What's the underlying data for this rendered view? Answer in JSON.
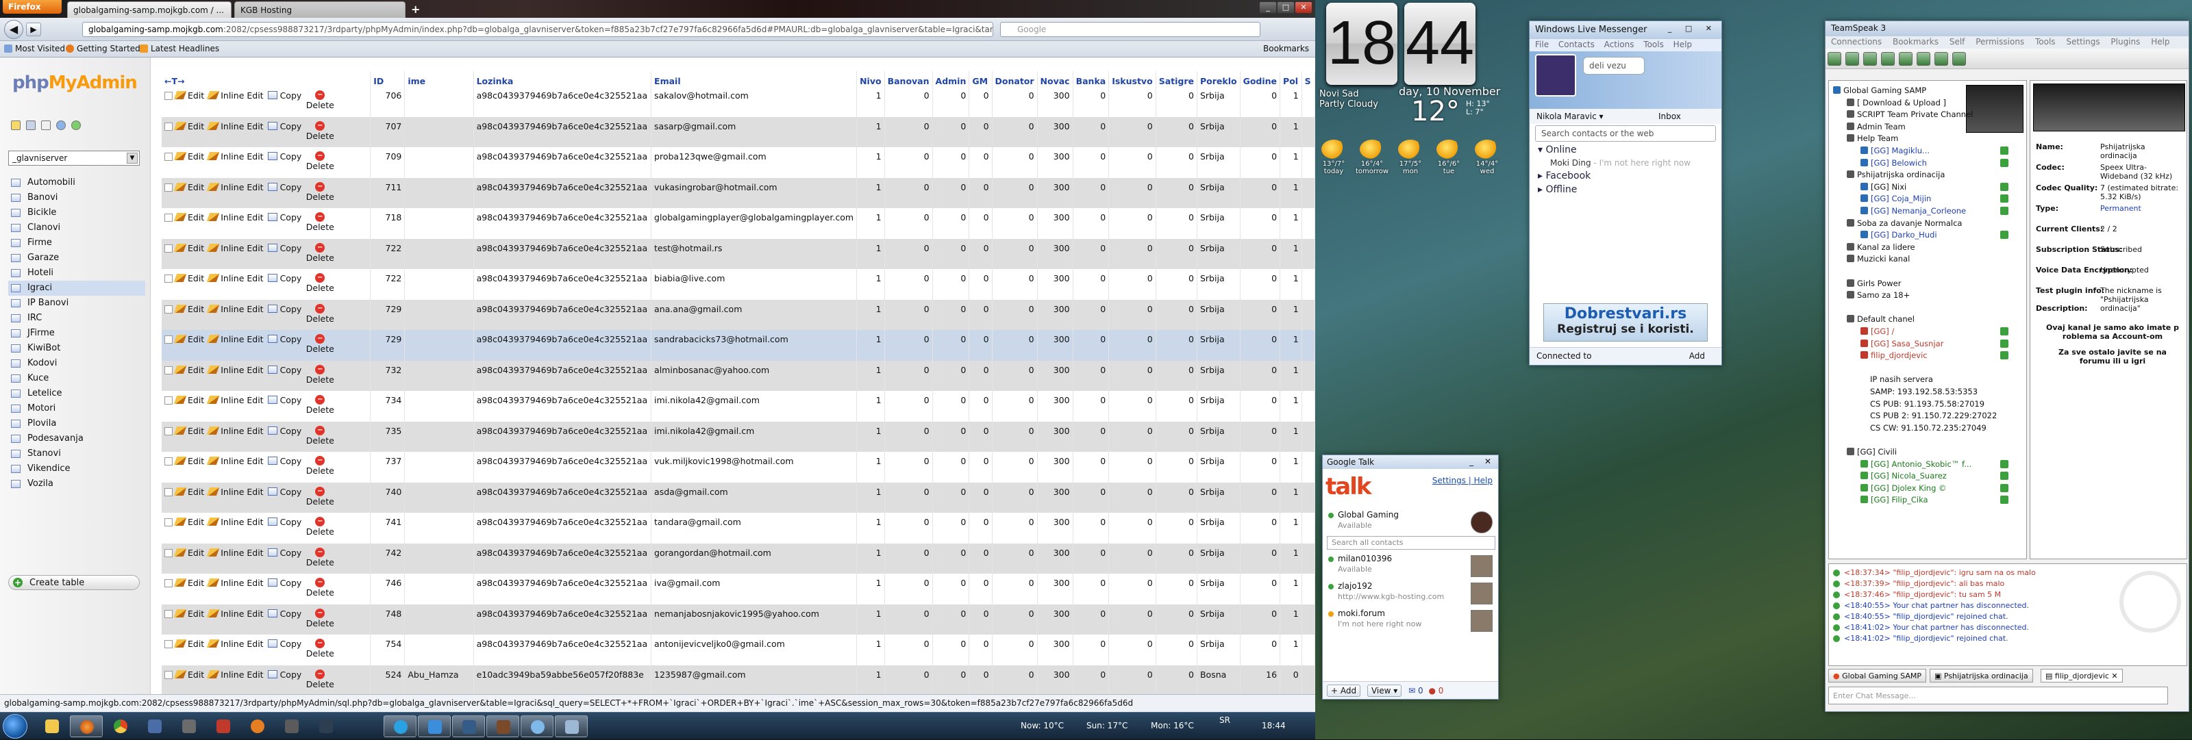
{
  "firefox": {
    "menu_label": "Firefox",
    "tabs": [
      {
        "label": "globalgaming-samp.mojkgb.com / ..."
      },
      {
        "label": "KGB Hosting"
      }
    ],
    "new_tab": "+",
    "url_host": "globalgaming-samp.mojkgb.com",
    "url_rest": ":2082/cpsess988873217/3rdparty/phpMyAdmin/index.php?db=globalga_glavniserver&token=f885a23b7cf27e797fa6c82966fa5d6d#PMAURL:db=globalga_glavniserver&table=Igraci&target=sql.php&t",
    "search_placeholder": "Google",
    "bookmarks": [
      "Most Visited",
      "Getting Started",
      "Latest Headlines"
    ],
    "bookmarks_right": "Bookmarks",
    "status_url": "globalgaming-samp.mojkgb.com:2082/cpsess988873217/3rdparty/phpMyAdmin/sql.php?db=globalga_glavniserver&table=Igraci&sql_query=SELECT+*+FROM+`Igraci`+ORDER+BY+`Igraci`.`ime`+ASC&session_max_rows=30&token=f885a23b7cf27e797fa6c82966fa5d6d"
  },
  "pma": {
    "logo_php": "php",
    "logo_my": "MyAdmin",
    "database": "_glavniserver",
    "tables": [
      "Automobili",
      "Banovi",
      "Bicikle",
      "Clanovi",
      "Firme",
      "Garaze",
      "Hoteli",
      "Igraci",
      "IP Banovi",
      "IRC",
      "JFirme",
      "KiwiBot",
      "Kodovi",
      "Kuce",
      "Letelice",
      "Motori",
      "Plovila",
      "Podesavanja",
      "Stanovi",
      "Vikendice",
      "Vozila"
    ],
    "selected_table": "Igraci",
    "create_table": "Create table",
    "nav_arrows": "←T→",
    "columns": [
      "ID",
      "ime",
      "Lozinka",
      "Email",
      "Nivo",
      "Banovan",
      "Admin",
      "GM",
      "Donator",
      "Novac",
      "Banka",
      "Iskustvo",
      "Satigre",
      "Poreklo",
      "Godine",
      "Pol",
      "S"
    ],
    "actions": {
      "edit": "Edit",
      "inline": "Inline Edit",
      "copy": "Copy",
      "delete": "Delete"
    },
    "rows": [
      [
        "706",
        "",
        "a98c0439379469b7a6ce0e4c325521aa",
        "sakalov@hotmail.com",
        "1",
        "0",
        "0",
        "0",
        "0",
        "300",
        "0",
        "0",
        "0",
        "Srbija",
        "0",
        "1"
      ],
      [
        "707",
        "",
        "a98c0439379469b7a6ce0e4c325521aa",
        "sasarp@gmail.com",
        "1",
        "0",
        "0",
        "0",
        "0",
        "300",
        "0",
        "0",
        "0",
        "Srbija",
        "0",
        "1"
      ],
      [
        "709",
        "",
        "a98c0439379469b7a6ce0e4c325521aa",
        "proba123qwe@gmail.com",
        "1",
        "0",
        "0",
        "0",
        "0",
        "300",
        "0",
        "0",
        "0",
        "Srbija",
        "0",
        "1"
      ],
      [
        "711",
        "",
        "a98c0439379469b7a6ce0e4c325521aa",
        "vukasingrobar@hotmail.com",
        "1",
        "0",
        "0",
        "0",
        "0",
        "300",
        "0",
        "0",
        "0",
        "Srbija",
        "0",
        "1"
      ],
      [
        "718",
        "",
        "a98c0439379469b7a6ce0e4c325521aa",
        "globalgamingplayer@globalgamingplayer.com",
        "1",
        "0",
        "0",
        "0",
        "0",
        "300",
        "0",
        "0",
        "0",
        "Srbija",
        "0",
        "1"
      ],
      [
        "722",
        "",
        "a98c0439379469b7a6ce0e4c325521aa",
        "test@hotmail.rs",
        "1",
        "0",
        "0",
        "0",
        "0",
        "300",
        "0",
        "0",
        "0",
        "Srbija",
        "0",
        "1"
      ],
      [
        "722",
        "",
        "a98c0439379469b7a6ce0e4c325521aa",
        "biabia@live.com",
        "1",
        "0",
        "0",
        "0",
        "0",
        "300",
        "0",
        "0",
        "0",
        "Srbija",
        "0",
        "1"
      ],
      [
        "729",
        "",
        "a98c0439379469b7a6ce0e4c325521aa",
        "ana.ana@gmail.com",
        "1",
        "0",
        "0",
        "0",
        "0",
        "300",
        "0",
        "0",
        "0",
        "Srbija",
        "0",
        "1"
      ],
      [
        "729",
        "",
        "a98c0439379469b7a6ce0e4c325521aa",
        "sandrabacicks73@hotmail.com",
        "1",
        "0",
        "0",
        "0",
        "0",
        "300",
        "0",
        "0",
        "0",
        "Srbija",
        "0",
        "1"
      ],
      [
        "732",
        "",
        "a98c0439379469b7a6ce0e4c325521aa",
        "alminbosanac@yahoo.com",
        "1",
        "0",
        "0",
        "0",
        "0",
        "300",
        "0",
        "0",
        "0",
        "Srbija",
        "0",
        "1"
      ],
      [
        "734",
        "",
        "a98c0439379469b7a6ce0e4c325521aa",
        "imi.nikola42@gmail.com",
        "1",
        "0",
        "0",
        "0",
        "0",
        "300",
        "0",
        "0",
        "0",
        "Srbija",
        "0",
        "1"
      ],
      [
        "735",
        "",
        "a98c0439379469b7a6ce0e4c325521aa",
        "imi.nikola42@gmail.cm",
        "1",
        "0",
        "0",
        "0",
        "0",
        "300",
        "0",
        "0",
        "0",
        "Srbija",
        "0",
        "1"
      ],
      [
        "737",
        "",
        "a98c0439379469b7a6ce0e4c325521aa",
        "vuk.miljkovic1998@hotmail.com",
        "1",
        "0",
        "0",
        "0",
        "0",
        "300",
        "0",
        "0",
        "0",
        "Srbija",
        "0",
        "1"
      ],
      [
        "740",
        "",
        "a98c0439379469b7a6ce0e4c325521aa",
        "asda@gmail.com",
        "1",
        "0",
        "0",
        "0",
        "0",
        "300",
        "0",
        "0",
        "0",
        "Srbija",
        "0",
        "1"
      ],
      [
        "741",
        "",
        "a98c0439379469b7a6ce0e4c325521aa",
        "tandara@gmail.com",
        "1",
        "0",
        "0",
        "0",
        "0",
        "300",
        "0",
        "0",
        "0",
        "Srbija",
        "0",
        "1"
      ],
      [
        "742",
        "",
        "a98c0439379469b7a6ce0e4c325521aa",
        "gorangordan@hotmail.com",
        "1",
        "0",
        "0",
        "0",
        "0",
        "300",
        "0",
        "0",
        "0",
        "Srbija",
        "0",
        "1"
      ],
      [
        "746",
        "",
        "a98c0439379469b7a6ce0e4c325521aa",
        "iva@gmail.com",
        "1",
        "0",
        "0",
        "0",
        "0",
        "300",
        "0",
        "0",
        "0",
        "Srbija",
        "0",
        "1"
      ],
      [
        "748",
        "",
        "a98c0439379469b7a6ce0e4c325521aa",
        "nemanjabosnjakovic1995@yahoo.com",
        "1",
        "0",
        "0",
        "0",
        "0",
        "300",
        "0",
        "0",
        "0",
        "Srbija",
        "0",
        "1"
      ],
      [
        "754",
        "",
        "a98c0439379469b7a6ce0e4c325521aa",
        "antonijevicveljko0@gmail.com",
        "1",
        "0",
        "0",
        "0",
        "0",
        "300",
        "0",
        "0",
        "0",
        "Srbija",
        "0",
        "1"
      ],
      [
        "524",
        "Abu_Hamza",
        "e10adc3949ba59abbe56e057f20f883e",
        "1235987@gmail.com",
        "1",
        "0",
        "0",
        "0",
        "0",
        "300",
        "0",
        "0",
        "0",
        "Bosna",
        "16",
        "0"
      ]
    ],
    "highlight_row": 8
  },
  "taskbar": {
    "weather": "Now: 10°C",
    "weather2": "Sun: 17°C",
    "weather3": "Mon: 16°C",
    "lang": "SR",
    "time": "18:44"
  },
  "clock": {
    "hour": "18",
    "minute": "44"
  },
  "weather": {
    "city": "Novi Sad",
    "cond": "Partly Cloudy",
    "date": "day, 10 November",
    "temp": "12°",
    "hi": "H: 13°",
    "lo": "L: 7°",
    "forecast": [
      {
        "t": "13°/7°",
        "d": "today"
      },
      {
        "t": "16°/4°",
        "d": "tomorrow"
      },
      {
        "t": "17°/5°",
        "d": "mon"
      },
      {
        "t": "16°/6°",
        "d": "tue"
      },
      {
        "t": "14°/4°",
        "d": "wed"
      }
    ]
  },
  "wlm": {
    "title": "Windows Live Messenger",
    "menu": "File Contacts Actions Tools Help",
    "status": "deli vezu",
    "name": "Nikola Maravic",
    "inbox": "Inbox",
    "search": "Search contacts or the web",
    "groups": [
      "Online",
      "Facebook",
      "Offline"
    ],
    "contact": "Moki Ding",
    "contact_note": "- I'm not here right now",
    "ad1": "Dobrestvari.rs",
    "ad2": "Registruj se i koristi.",
    "connected": "Connected to",
    "add": "Add"
  },
  "gtalk": {
    "title": "Google Talk",
    "logo": "talk",
    "settings": "Settings",
    "help": "Help",
    "me_name": "Global Gaming",
    "me_status": "Available",
    "search": "Search all contacts",
    "contacts": [
      {
        "name": "milan010396",
        "status": "Available"
      },
      {
        "name": "zlajo192",
        "status": "http://www.kgb-hosting.com"
      },
      {
        "name": "moki.forum",
        "status": "I'm not here right now"
      }
    ],
    "add": "Add",
    "view": "View",
    "count1": "0",
    "count2": "0"
  },
  "ts": {
    "title": "TeamSpeak 3",
    "menu": "Connections Bookmarks Self Permissions Tools Settings Plugins Help",
    "tree": [
      {
        "t": "Global Gaming SAMP",
        "c": "center",
        "i": 0
      },
      {
        "t": "[ Download & Upload ]",
        "c": "center",
        "i": 1
      },
      {
        "t": "SCRIPT Team Private Channel",
        "c": "center",
        "i": 1
      },
      {
        "t": "Admin Team",
        "c": "center",
        "i": 1
      },
      {
        "t": "Help Team",
        "c": "center",
        "i": 1
      },
      {
        "t": "[GG] Magiklu...",
        "c": "usrb",
        "i": 2
      },
      {
        "t": "[GG] Belowich",
        "c": "usrb",
        "i": 2
      },
      {
        "t": "Pshijatrijska ordinacija",
        "c": "center",
        "i": 1
      },
      {
        "t": "[GG] Nixi",
        "c": "center",
        "i": 2
      },
      {
        "t": "[GG] Coja_Mijin",
        "c": "usrb",
        "i": 2
      },
      {
        "t": "[GG] Nemanja_Corleone",
        "c": "usrb",
        "i": 2
      },
      {
        "t": "Soba za davanje Normalca",
        "c": "center",
        "i": 1
      },
      {
        "t": "[GG] Darko_Hudi",
        "c": "usrb",
        "i": 2
      },
      {
        "t": "Kanal za lidere",
        "c": "center",
        "i": 1
      },
      {
        "t": "Muzicki kanal",
        "c": "center",
        "i": 1
      },
      {
        "t": "",
        "c": "center",
        "i": 1
      },
      {
        "t": "Girls Power",
        "c": "center",
        "i": 1
      },
      {
        "t": "Samo za 18+",
        "c": "center",
        "i": 1
      },
      {
        "t": "",
        "c": "center",
        "i": 1
      },
      {
        "t": "Default chanel",
        "c": "center",
        "i": 1
      },
      {
        "t": "[GG] /",
        "c": "user",
        "i": 2
      },
      {
        "t": "[GG] Sasa_Susnjar",
        "c": "user",
        "i": 2
      },
      {
        "t": "filip_djordjevic",
        "c": "user",
        "i": 2
      },
      {
        "t": "",
        "c": "center",
        "i": 1
      },
      {
        "t": "IP nasih servera",
        "c": "center",
        "i": 3
      },
      {
        "t": "SAMP: 193.192.58.53:5353",
        "c": "center",
        "i": 3
      },
      {
        "t": "CS PUB: 91.193.75.58:27019",
        "c": "center",
        "i": 3
      },
      {
        "t": "CS PUB 2: 91.150.72.229:27022",
        "c": "center",
        "i": 3
      },
      {
        "t": "CS CW: 91.150.72.235:27049",
        "c": "center",
        "i": 3
      },
      {
        "t": "",
        "c": "center",
        "i": 1
      },
      {
        "t": "[GG] Civili",
        "c": "center",
        "i": 1
      },
      {
        "t": "[GG] Antonio_Skobic™ f...",
        "c": "usrg",
        "i": 2
      },
      {
        "t": "[GG] Nicola_Suarez",
        "c": "usrg",
        "i": 2
      },
      {
        "t": "[GG] Djolex King ©",
        "c": "usrg",
        "i": 2
      },
      {
        "t": "[GG] Filip_Cika",
        "c": "usrg",
        "i": 2
      }
    ],
    "info": [
      {
        "k": "Name:",
        "v": "Pshijatrijska ordinacija"
      },
      {
        "k": "Codec:",
        "v": "Speex Ultra-Wideband (32 kHz)"
      },
      {
        "k": "Codec Quality:",
        "v": "7 (estimated bitrate: 5.32 KiB/s)"
      },
      {
        "k": "Type:",
        "v": "Permanent"
      },
      {
        "k": "Current Clients:",
        "v": "2 / 2"
      },
      {
        "k": "Subscription Status:",
        "v": "Subscribed"
      },
      {
        "k": "Voice Data Encryption:",
        "v": "Unencrypted"
      },
      {
        "k": "Test plugin info:",
        "v": "The nickname is \"Pshijatrijska ordinacija\""
      }
    ],
    "desc_label": "Description:",
    "desc1": "Ovaj kanal je samo ako imate p roblema sa Account-om",
    "desc2": "Za sve ostalo javite se na forumu ili u igri",
    "chat": [
      {
        "time": "<18:37:34>",
        "msg": "\"filip_djordjevic\": igru sam na os malo",
        "c": "#c0392b"
      },
      {
        "time": "<18:37:39>",
        "msg": "\"filip_djordjevic\": ali bas malo",
        "c": "#c0392b"
      },
      {
        "time": "<18:37:46>",
        "msg": "\"filip_djordjevic\": tu sam 5 M",
        "c": "#c0392b"
      },
      {
        "time": "<18:40:55>",
        "msg": "Your chat partner has disconnected.",
        "c": "#1e3fb4"
      },
      {
        "time": "<18:40:55>",
        "msg": "\"filip_djordjevic\" rejoined chat.",
        "c": "#1e3fb4"
      },
      {
        "time": "<18:41:02>",
        "msg": "Your chat partner has disconnected.",
        "c": "#1e3fb4"
      },
      {
        "time": "<18:41:02>",
        "msg": "\"filip_djordjevic\" rejoined chat.",
        "c": "#1e3fb4"
      }
    ],
    "tabs": [
      "Global Gaming SAMP",
      "Pshijatrijska ordinacija",
      "filip_djordjevic"
    ],
    "input": "Enter Chat Message..."
  }
}
